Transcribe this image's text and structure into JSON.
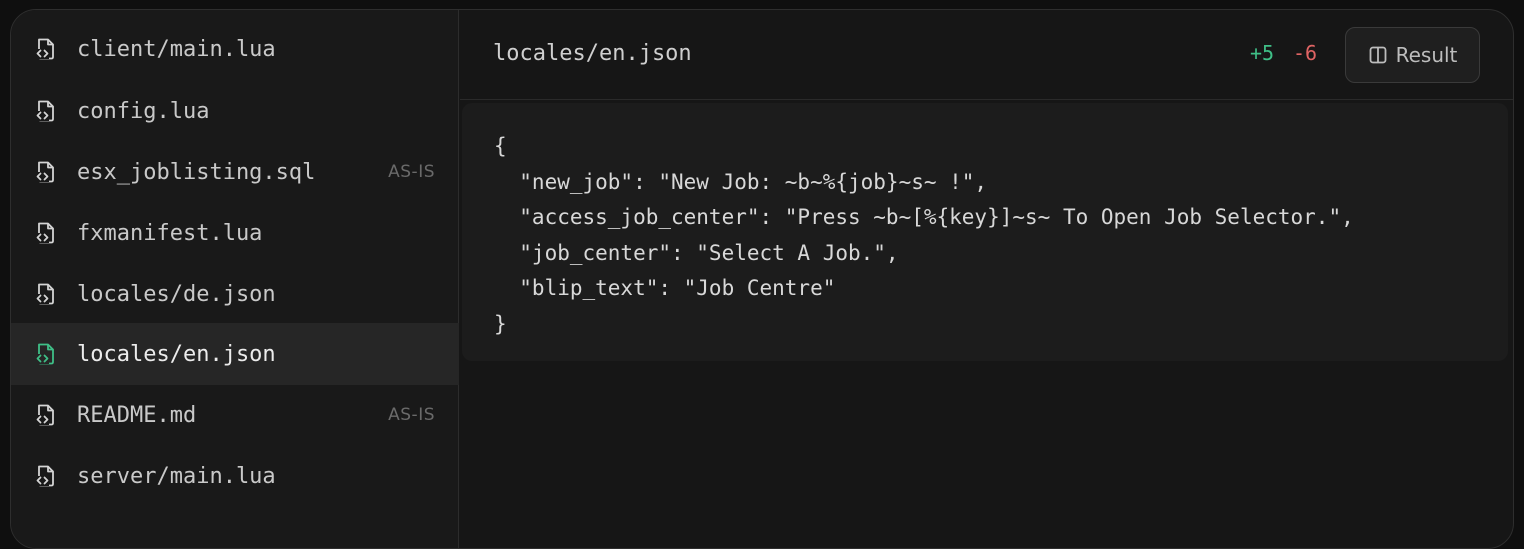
{
  "sidebar": {
    "files": [
      {
        "name": "client/main.lua",
        "badge": "",
        "active": false
      },
      {
        "name": "config.lua",
        "badge": "",
        "active": false
      },
      {
        "name": "esx_joblisting.sql",
        "badge": "AS-IS",
        "active": false
      },
      {
        "name": "fxmanifest.lua",
        "badge": "",
        "active": false
      },
      {
        "name": "locales/de.json",
        "badge": "",
        "active": false
      },
      {
        "name": "locales/en.json",
        "badge": "",
        "active": true
      },
      {
        "name": "README.md",
        "badge": "AS-IS",
        "active": false
      },
      {
        "name": "server/main.lua",
        "badge": "",
        "active": false
      }
    ]
  },
  "header": {
    "current_file": "locales/en.json",
    "additions": "+5",
    "deletions": "-6",
    "result_label": "Result"
  },
  "code": {
    "lines": [
      "{",
      "  \"new_job\": \"New Job: ~b~%{job}~s~ !\",",
      "  \"access_job_center\": \"Press ~b~[%{key}]~s~ To Open Job Selector.\",",
      "  \"job_center\": \"Select A Job.\",",
      "  \"blip_text\": \"Job Centre\"",
      "}"
    ]
  },
  "colors": {
    "accent": "#3fbf87",
    "deletion": "#e06464",
    "icon_default": "#d4d4d4"
  }
}
